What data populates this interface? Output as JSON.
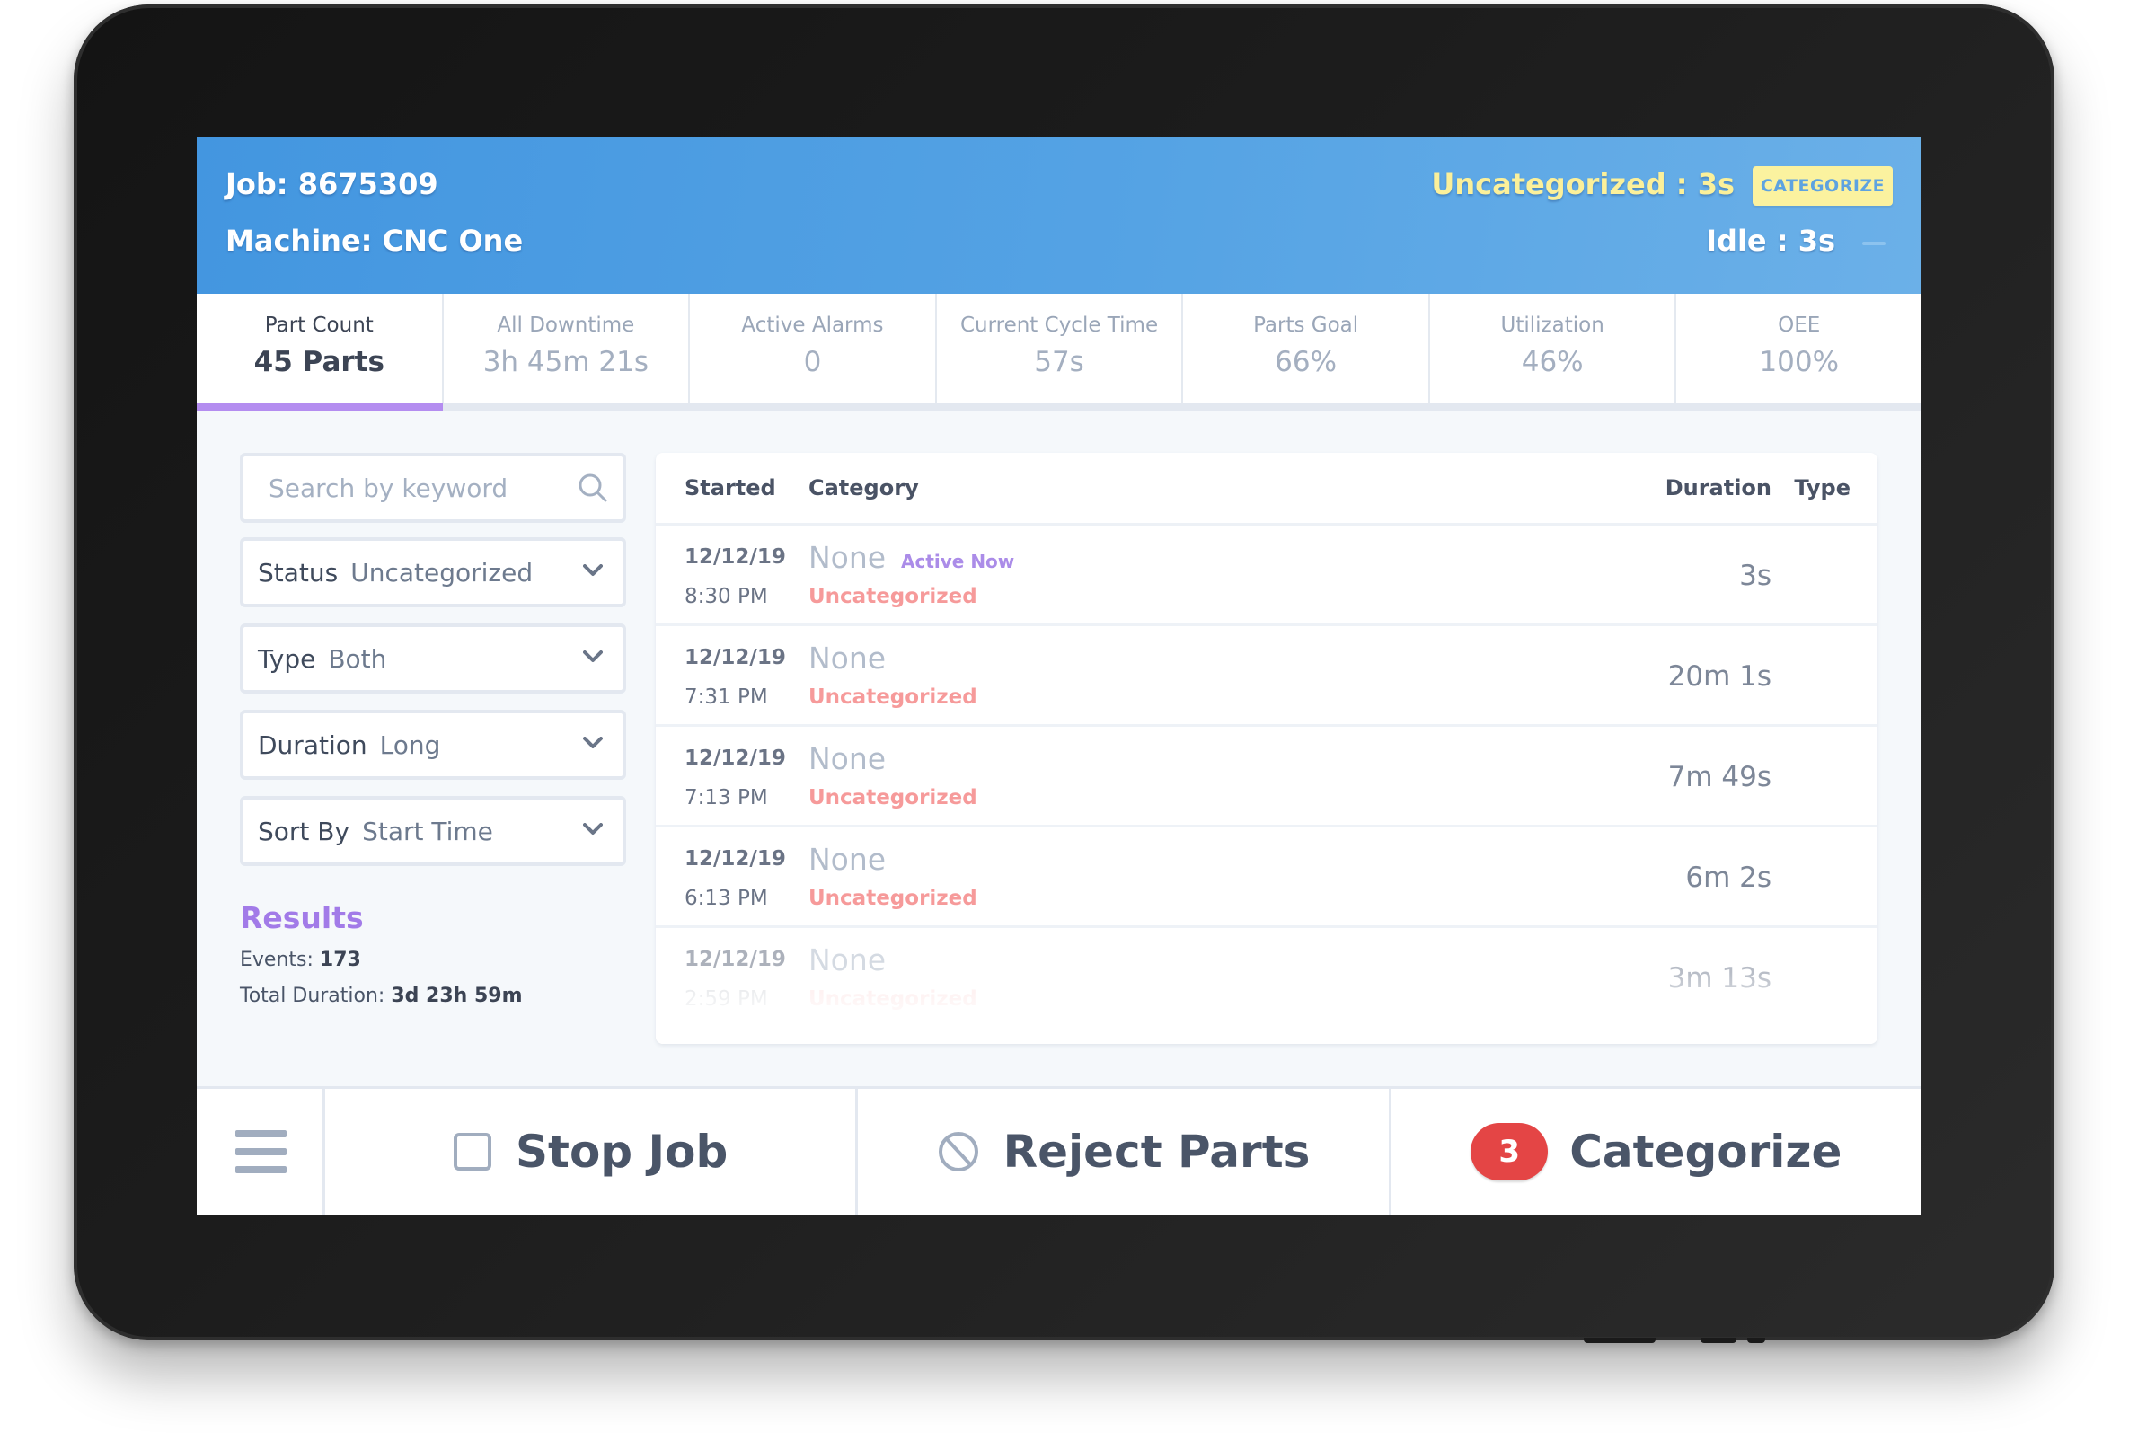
{
  "header": {
    "job": "Job: 8675309",
    "machine": "Machine: CNC One",
    "uncategorized_status": "Uncategorized : 3s",
    "categorize_badge": "CATEGORIZE",
    "idle_status": "Idle : 3s"
  },
  "stats": [
    {
      "label": "Part Count",
      "value": "45 Parts",
      "active": true
    },
    {
      "label": "All Downtime",
      "value": "3h 45m 21s"
    },
    {
      "label": "Active Alarms",
      "value": "0"
    },
    {
      "label": "Current Cycle Time",
      "value": "57s"
    },
    {
      "label": "Parts Goal",
      "value": "66%"
    },
    {
      "label": "Utilization",
      "value": "46%"
    },
    {
      "label": "OEE",
      "value": "100%"
    }
  ],
  "filters": {
    "search_placeholder": "Search by keyword",
    "status": {
      "label": "Status",
      "value": "Uncategorized"
    },
    "type": {
      "label": "Type",
      "value": "Both"
    },
    "duration": {
      "label": "Duration",
      "value": "Long"
    },
    "sort_by": {
      "label": "Sort By",
      "value": "Start Time"
    }
  },
  "results": {
    "title": "Results",
    "events_label": "Events:",
    "events_value": "173",
    "total_duration_label": "Total Duration:",
    "total_duration_value": "3d 23h 59m"
  },
  "table": {
    "columns": [
      "Started",
      "Category",
      "Duration",
      "Type"
    ],
    "rows": [
      {
        "date": "12/12/19",
        "time": "8:30 PM",
        "category": "None",
        "status": "Uncategorized",
        "tag": "Active Now",
        "duration": "3s",
        "type": ""
      },
      {
        "date": "12/12/19",
        "time": "7:31 PM",
        "category": "None",
        "status": "Uncategorized",
        "duration": "20m 1s",
        "type": ""
      },
      {
        "date": "12/12/19",
        "time": "7:13 PM",
        "category": "None",
        "status": "Uncategorized",
        "duration": "7m 49s",
        "type": ""
      },
      {
        "date": "12/12/19",
        "time": "6:13 PM",
        "category": "None",
        "status": "Uncategorized",
        "duration": "6m 2s",
        "type": ""
      },
      {
        "date": "12/12/19",
        "time": "2:59 PM",
        "category": "None",
        "status": "Uncategorized",
        "duration": "3m 13s",
        "type": ""
      }
    ]
  },
  "footer": {
    "menu_icon": "hamburger-icon",
    "stop_job": "Stop Job",
    "reject_parts": "Reject Parts",
    "categorize": "Categorize",
    "categorize_count": "3"
  },
  "colors": {
    "header_blue": "#4396e0",
    "accent_purple": "#b48df0",
    "uncategorized_red": "#f69a9a",
    "highlight_yellow": "#fbf29f",
    "badge_red": "#e44545"
  }
}
